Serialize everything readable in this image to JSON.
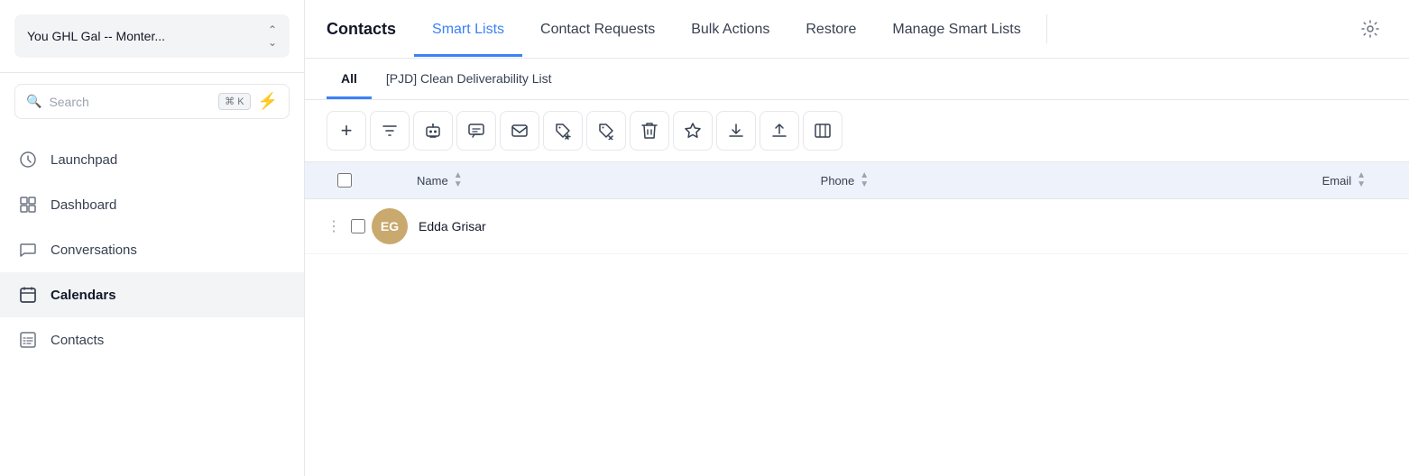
{
  "sidebar": {
    "workspace": {
      "name": "You GHL Gal -- Monter...",
      "chevron": "⌃"
    },
    "search": {
      "placeholder": "Search",
      "kbd": "⌘ K"
    },
    "lightning": "⚡",
    "nav_items": [
      {
        "id": "launchpad",
        "label": "Launchpad",
        "icon": "launchpad"
      },
      {
        "id": "dashboard",
        "label": "Dashboard",
        "icon": "dashboard"
      },
      {
        "id": "conversations",
        "label": "Conversations",
        "icon": "conversations"
      },
      {
        "id": "calendars",
        "label": "Calendars",
        "icon": "calendars",
        "active": true
      },
      {
        "id": "contacts",
        "label": "Contacts",
        "icon": "contacts"
      }
    ]
  },
  "main": {
    "top_nav": {
      "tabs": [
        {
          "id": "contacts",
          "label": "Contacts",
          "active": false,
          "bold": true
        },
        {
          "id": "smart-lists",
          "label": "Smart Lists",
          "active": true
        },
        {
          "id": "contact-requests",
          "label": "Contact Requests",
          "active": false
        },
        {
          "id": "bulk-actions",
          "label": "Bulk Actions",
          "active": false
        },
        {
          "id": "restore",
          "label": "Restore",
          "active": false
        },
        {
          "id": "manage-smart-lists",
          "label": "Manage Smart Lists",
          "active": false
        }
      ]
    },
    "sub_tabs": [
      {
        "id": "all",
        "label": "All",
        "active": true
      },
      {
        "id": "pjd",
        "label": "[PJD] Clean Deliverability List",
        "active": false
      }
    ],
    "toolbar": {
      "buttons": [
        {
          "id": "add",
          "icon": "+",
          "label": "Add Contact"
        },
        {
          "id": "filter",
          "icon": "filter",
          "label": "Filter"
        },
        {
          "id": "bot",
          "icon": "bot",
          "label": "Bot"
        },
        {
          "id": "message",
          "icon": "message",
          "label": "Message"
        },
        {
          "id": "email",
          "icon": "email",
          "label": "Email"
        },
        {
          "id": "add-tag",
          "icon": "add-tag",
          "label": "Add Tag"
        },
        {
          "id": "remove-tag",
          "icon": "remove-tag",
          "label": "Remove Tag"
        },
        {
          "id": "delete",
          "icon": "delete",
          "label": "Delete"
        },
        {
          "id": "star",
          "icon": "star",
          "label": "Star"
        },
        {
          "id": "download",
          "icon": "download",
          "label": "Download"
        },
        {
          "id": "upload",
          "icon": "upload",
          "label": "Upload"
        },
        {
          "id": "columns",
          "icon": "columns",
          "label": "Columns"
        }
      ]
    },
    "table": {
      "columns": [
        {
          "id": "name",
          "label": "Name"
        },
        {
          "id": "phone",
          "label": "Phone"
        },
        {
          "id": "email",
          "label": "Email"
        }
      ],
      "rows": [
        {
          "id": "1",
          "initials": "EG",
          "avatar_color": "#c9a96e",
          "name": "Edda Grisar",
          "phone": "",
          "email": ""
        }
      ]
    }
  }
}
